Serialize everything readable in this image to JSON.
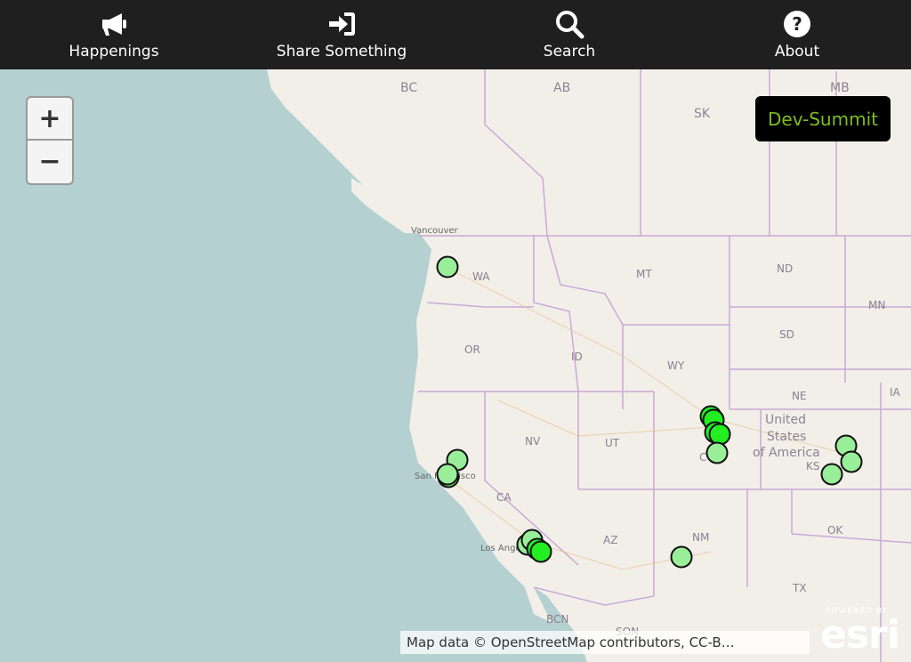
{
  "nav": {
    "items": [
      {
        "label": "Happenings",
        "icon": "megaphone-icon"
      },
      {
        "label": "Share Something",
        "icon": "sign-in-icon"
      },
      {
        "label": "Search",
        "icon": "search-icon"
      },
      {
        "label": "About",
        "icon": "question-circle-icon"
      }
    ]
  },
  "zoom": {
    "in_label": "+",
    "out_label": "−"
  },
  "badge": {
    "label": "Dev-Summit"
  },
  "attribution": {
    "text": "Map data © OpenStreetMap contributors, CC-B…"
  },
  "esri": {
    "powered": "POWERED BY",
    "word": "esri"
  },
  "map_labels": {
    "bc": "BC",
    "ab": "AB",
    "sk": "SK",
    "mb": "MB",
    "wa": "WA",
    "mt": "MT",
    "nd": "ND",
    "mn": "MN",
    "or": "OR",
    "id": "ID",
    "wy": "WY",
    "sd": "SD",
    "ne": "NE",
    "ia": "IA",
    "nv": "NV",
    "ut": "UT",
    "co": "CO",
    "ks": "KS",
    "ca": "CA",
    "az": "AZ",
    "nm": "NM",
    "ok": "OK",
    "tx": "TX",
    "bcn": "BCN",
    "son": "SON",
    "vancouver": "Vancouver",
    "san_francisco": "San Francisco",
    "los_angeles": "Los Angeles",
    "us_line1": "United",
    "us_line2": "States",
    "us_line3": "of America"
  },
  "colors": {
    "topbar": "#1f1f1f",
    "water": "#b5d0d0",
    "land": "#f2efe9",
    "border": "#c9a9d6",
    "marker_light": "#99ee99",
    "marker_bright": "#22ee22",
    "badge_text": "#7dbd1e"
  }
}
